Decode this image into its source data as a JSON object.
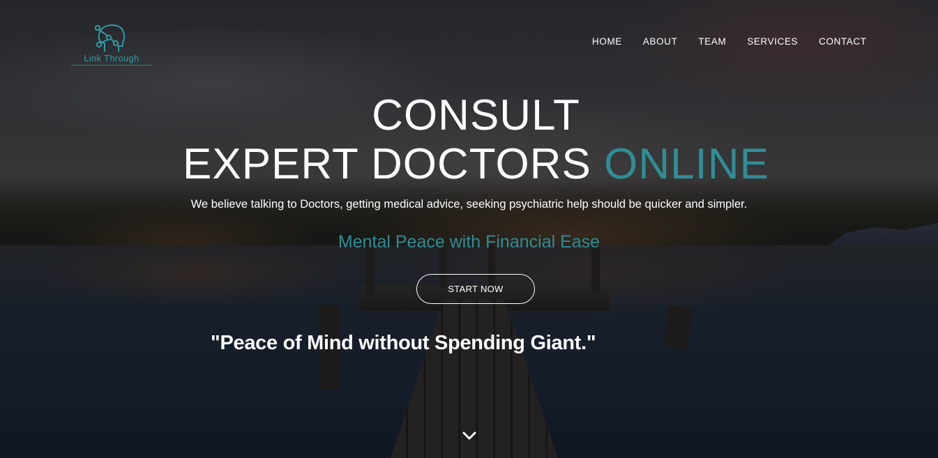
{
  "logo": {
    "text": "Link Through",
    "icon": "brain-network-icon"
  },
  "nav": {
    "items": [
      {
        "label": "HOME"
      },
      {
        "label": "ABOUT"
      },
      {
        "label": "TEAM"
      },
      {
        "label": "SERVICES"
      },
      {
        "label": "CONTACT"
      }
    ]
  },
  "hero": {
    "line1": "CONSULT",
    "line2_main": "EXPERT DOCTORS",
    "line2_accent": "ONLINE",
    "tagline": "We believe talking to Doctors, getting medical advice, seeking psychiatric help should be quicker and simpler.",
    "subtagline": "Mental Peace with Financial Ease",
    "cta_label": "START NOW",
    "quote": "\"Peace of Mind without Spending Giant.\"",
    "scroll_icon": "chevron-down-icon"
  },
  "colors": {
    "accent": "#2f8d96",
    "text": "#ffffff"
  }
}
